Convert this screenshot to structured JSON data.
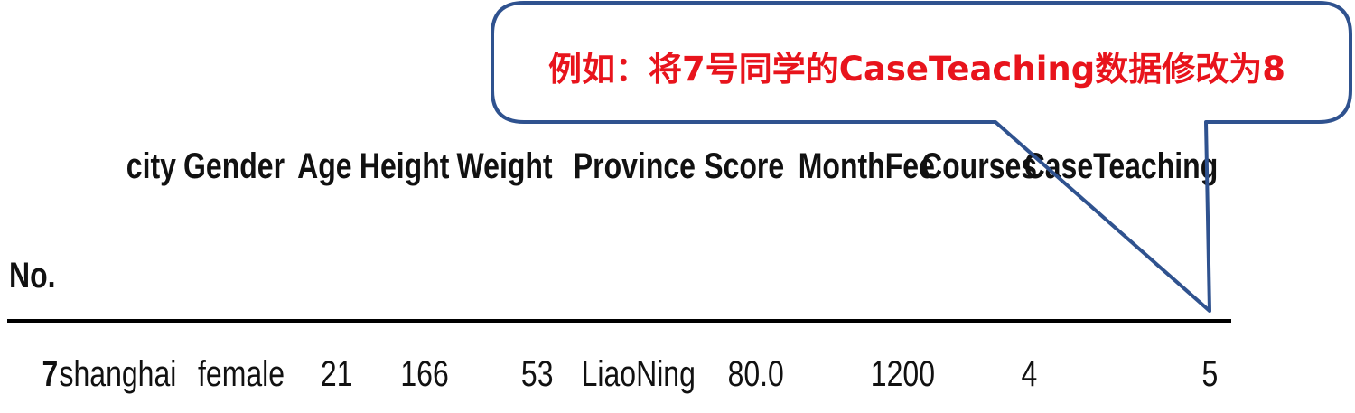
{
  "table": {
    "columns": [
      "city",
      "Gender",
      "Age",
      "Height",
      "Weight",
      "Province",
      "Score",
      "MonthFee",
      "Courses",
      "CaseTeaching"
    ],
    "index_name": "No.",
    "rows": [
      {
        "index": "7",
        "cells": [
          "shanghai",
          "female",
          "21",
          "166",
          "53",
          "LiaoNing",
          "80.0",
          "1200",
          "4",
          "5"
        ]
      }
    ]
  },
  "callout": {
    "text": "例如：将7号同学的CaseTeaching数据修改为8",
    "text_color": "#e8141c",
    "border_color": "#2f528f"
  }
}
